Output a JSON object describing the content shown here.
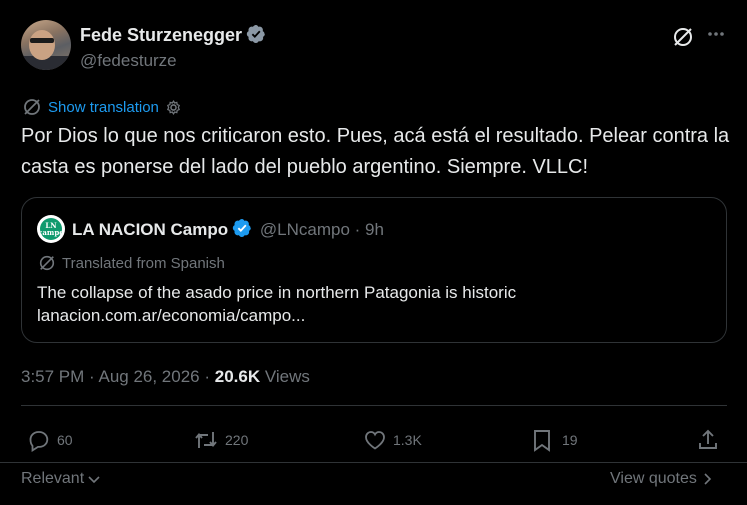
{
  "author": {
    "name": "Fede Sturzenegger",
    "handle": "@fedesturze"
  },
  "translation": {
    "show_label": "Show translation"
  },
  "tweet": {
    "text": "Por Dios lo que nos criticaron esto. Pues, acá está el resultado. Pelear contra la casta es ponerse del lado del pueblo argentino. Siempre. VLLC!"
  },
  "quote": {
    "logo_text": "LN campo",
    "name": "LA NACION Campo",
    "handle_time": "@LNcampo · 9h",
    "translated_label": "Translated from Spanish",
    "text": "The collapse of the asado price in northern Patagonia is historic",
    "link": "lanacion.com.ar/economia/campo..."
  },
  "meta": {
    "datetime": "3:57 PM · Aug 26, 2026 · ",
    "views_count": "20.6K",
    "views_label": " Views"
  },
  "actions": {
    "replies": "60",
    "reposts": "220",
    "likes": "1.3K",
    "bookmarks": "19"
  },
  "footer": {
    "sort_label": "Relevant",
    "view_quotes_label": "View quotes"
  },
  "colors": {
    "background": "#000000",
    "accent": "#1d9bf0",
    "muted": "#71767b",
    "text": "#e7e9ea",
    "border": "#2f3336"
  },
  "icons": [
    "verified-badge-icon",
    "grok-icon",
    "more-icon",
    "translate-icon",
    "settings-icon",
    "reply-icon",
    "repost-icon",
    "like-icon",
    "bookmark-icon",
    "share-icon",
    "chevron-down-icon",
    "chevron-right-icon"
  ]
}
